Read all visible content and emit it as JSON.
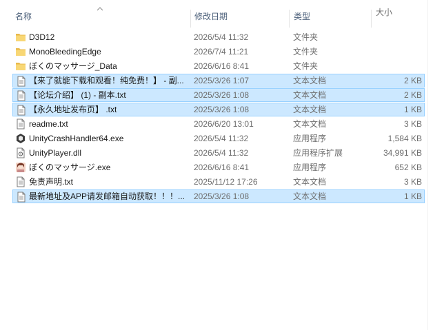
{
  "columns": {
    "name": "名称",
    "date": "修改日期",
    "type": "类型",
    "size": "大小"
  },
  "files": [
    {
      "name": "D3D12",
      "date": "2026/5/4 11:32",
      "type": "文件夹",
      "size": "",
      "icon": "folder-icon",
      "selected": false
    },
    {
      "name": "MonoBleedingEdge",
      "date": "2026/7/4 11:21",
      "type": "文件夹",
      "size": "",
      "icon": "folder-icon",
      "selected": false
    },
    {
      "name": "ぼくのマッサージ_Data",
      "date": "2026/6/16 8:41",
      "type": "文件夹",
      "size": "",
      "icon": "folder-icon",
      "selected": false
    },
    {
      "name": "【来了就能下载和观看！纯免费！】 - 副...",
      "date": "2025/3/26 1:07",
      "type": "文本文档",
      "size": "2 KB",
      "icon": "text-file-icon",
      "selected": true
    },
    {
      "name": "【论坛介绍】 (1) - 副本.txt",
      "date": "2025/3/26 1:08",
      "type": "文本文档",
      "size": "2 KB",
      "icon": "text-file-icon",
      "selected": true
    },
    {
      "name": "【永久地址发布页】 .txt",
      "date": "2025/3/26 1:08",
      "type": "文本文档",
      "size": "1 KB",
      "icon": "text-file-icon",
      "selected": true
    },
    {
      "name": "readme.txt",
      "date": "2026/6/20 13:01",
      "type": "文本文档",
      "size": "3 KB",
      "icon": "text-file-icon",
      "selected": false
    },
    {
      "name": "UnityCrashHandler64.exe",
      "date": "2026/5/4 11:32",
      "type": "应用程序",
      "size": "1,584 KB",
      "icon": "unity-exe-icon",
      "selected": false
    },
    {
      "name": "UnityPlayer.dll",
      "date": "2026/5/4 11:32",
      "type": "应用程序扩展",
      "size": "34,991 KB",
      "icon": "dll-file-icon",
      "selected": false
    },
    {
      "name": "ぼくのマッサージ.exe",
      "date": "2026/6/16 8:41",
      "type": "应用程序",
      "size": "652 KB",
      "icon": "game-exe-icon",
      "selected": false
    },
    {
      "name": "免责声明.txt",
      "date": "2025/11/12 17:26",
      "type": "文本文档",
      "size": "3 KB",
      "icon": "text-file-icon",
      "selected": false
    },
    {
      "name": "最新地址及APP请发邮箱自动获取！！！...",
      "date": "2025/3/26 1:08",
      "type": "文本文档",
      "size": "1 KB",
      "icon": "text-file-icon",
      "selected": true
    }
  ],
  "colors": {
    "selection_bg": "#cce8ff",
    "selection_border": "#99d1ff",
    "folder": "#f8d775",
    "header_text": "#4c607a"
  }
}
